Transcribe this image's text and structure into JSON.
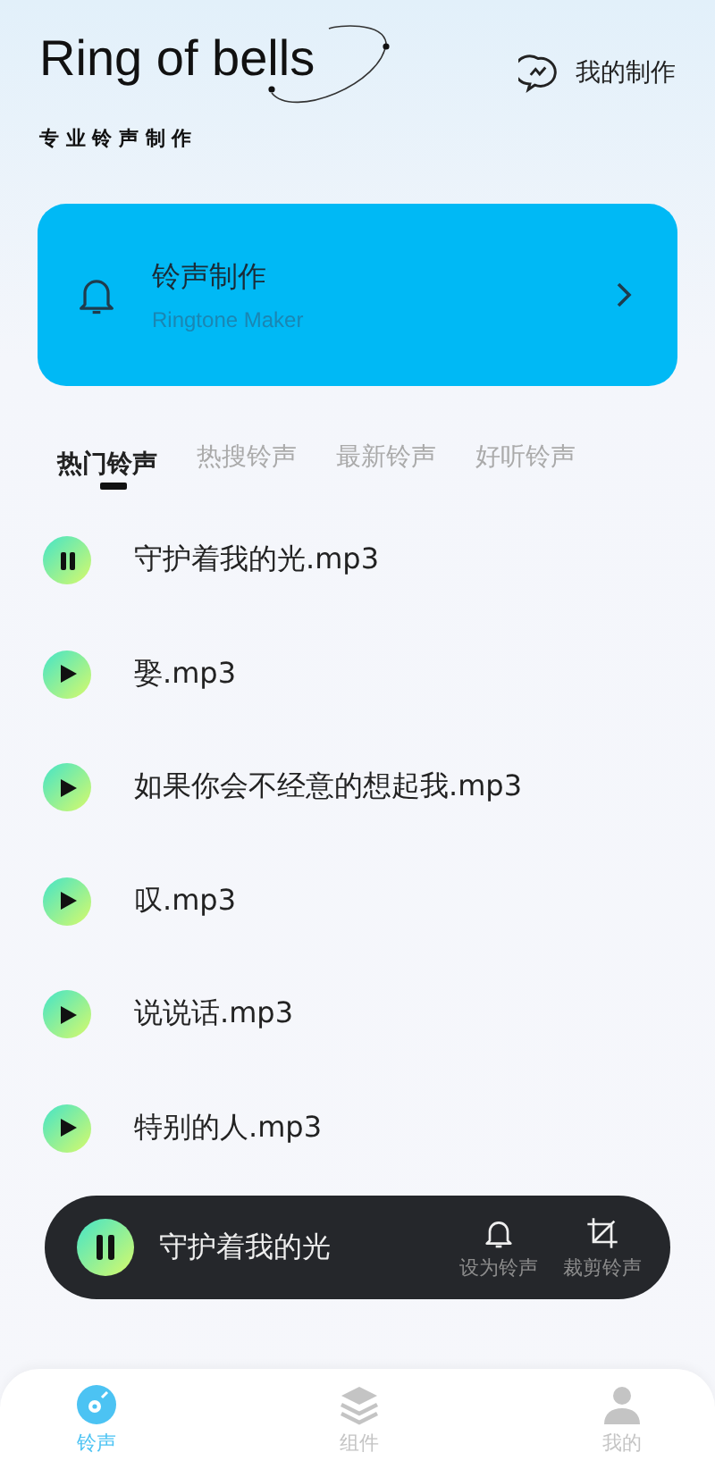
{
  "header": {
    "title": "Ring of bells",
    "subtitle": "专 业 铃 声 制 作",
    "my_works": "我的制作"
  },
  "maker_card": {
    "title": "铃声制作",
    "subtitle": "Ringtone Maker"
  },
  "tabs": [
    {
      "label": "热门铃声",
      "selected": true
    },
    {
      "label": "热搜铃声",
      "selected": false
    },
    {
      "label": "最新铃声",
      "selected": false
    },
    {
      "label": "好听铃声",
      "selected": false
    }
  ],
  "songs": [
    {
      "name": "守护着我的光.mp3",
      "playing": true
    },
    {
      "name": "娶.mp3",
      "playing": false
    },
    {
      "name": "如果你会不经意的想起我.mp3",
      "playing": false
    },
    {
      "name": "叹.mp3",
      "playing": false
    },
    {
      "name": "说说话.mp3",
      "playing": false
    },
    {
      "name": "特别的人.mp3",
      "playing": false
    }
  ],
  "player": {
    "title": "守护着我的光",
    "playing": true,
    "actions": [
      {
        "kind": "bell",
        "label": "设为铃声"
      },
      {
        "kind": "crop",
        "label": "裁剪铃声"
      }
    ]
  },
  "bottom_nav": [
    {
      "kind": "disc",
      "label": "铃声",
      "selected": true
    },
    {
      "kind": "layers",
      "label": "组件",
      "selected": false
    },
    {
      "kind": "person",
      "label": "我的",
      "selected": false
    }
  ]
}
